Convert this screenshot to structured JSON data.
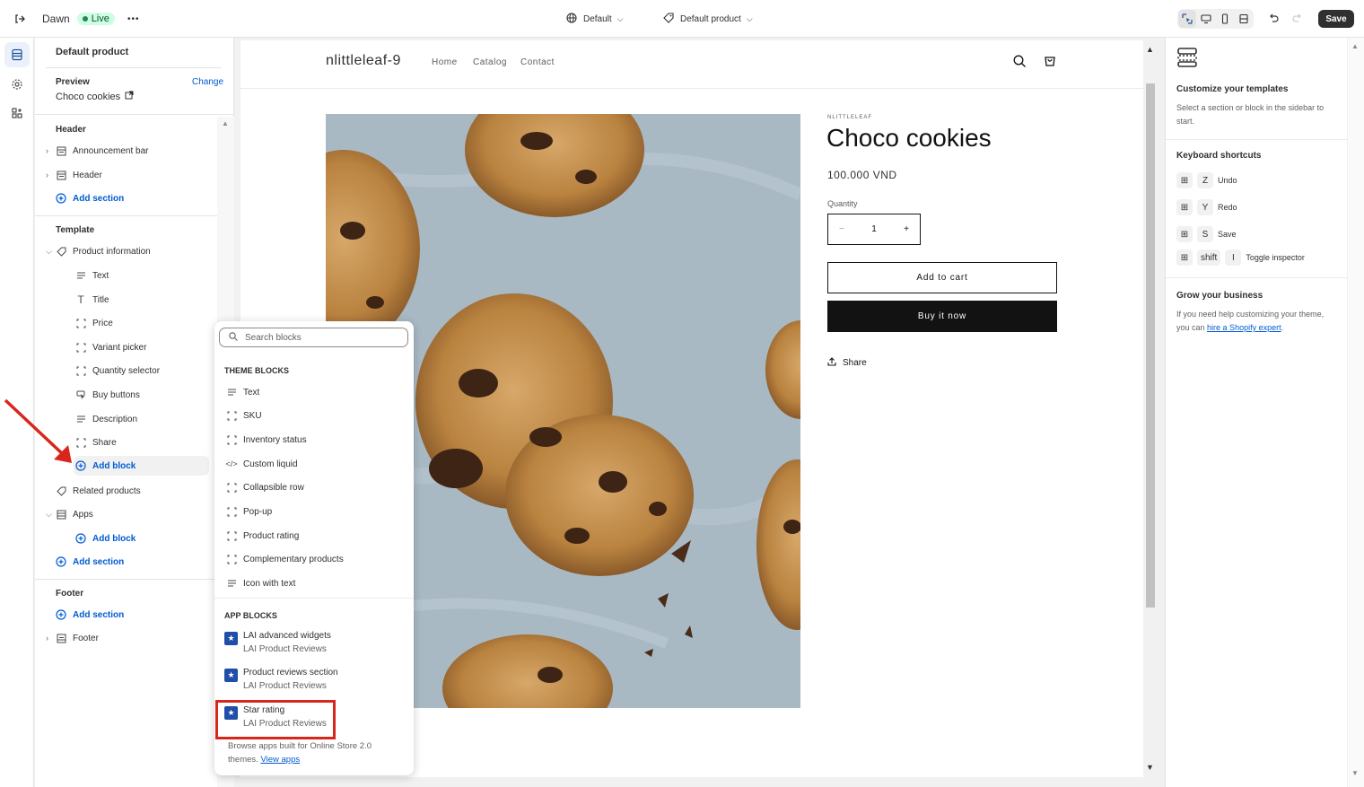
{
  "topbar": {
    "theme_name": "Dawn",
    "status": "Live",
    "more": "•••",
    "template_selector": "Default",
    "product_selector": "Default product",
    "save_label": "Save"
  },
  "sidebar": {
    "title": "Default product",
    "preview_label": "Preview",
    "preview_change": "Change",
    "preview_value": "Choco cookies",
    "header_group": "Header",
    "header_items": [
      "Announcement bar",
      "Header"
    ],
    "add_section": "Add section",
    "template_group": "Template",
    "product_information": "Product information",
    "blocks": [
      "Text",
      "Title",
      "Price",
      "Variant picker",
      "Quantity selector",
      "Buy buttons",
      "Description",
      "Share"
    ],
    "add_block": "Add block",
    "related_products": "Related products",
    "apps": "Apps",
    "footer_group": "Footer",
    "footer_item": "Footer"
  },
  "popup": {
    "search_placeholder": "Search blocks",
    "theme_blocks_heading": "THEME BLOCKS",
    "theme_blocks": [
      "Text",
      "SKU",
      "Inventory status",
      "Custom liquid",
      "Collapsible row",
      "Pop-up",
      "Product rating",
      "Complementary products",
      "Icon with text"
    ],
    "app_blocks_heading": "APP BLOCKS",
    "app_blocks": [
      {
        "name": "LAI advanced widgets",
        "vendor": "LAI Product Reviews"
      },
      {
        "name": "Product reviews section",
        "vendor": "LAI Product Reviews"
      },
      {
        "name": "Star rating",
        "vendor": "LAI Product Reviews"
      }
    ],
    "footer_text": "Browse apps built for Online Store 2.0 themes.",
    "footer_link": "View apps"
  },
  "store": {
    "name": "nlittleleaf-9",
    "nav": [
      "Home",
      "Catalog",
      "Contact"
    ],
    "vendor": "NLITTLELEAF",
    "product_title": "Choco cookies",
    "price": "100.000 VND",
    "quantity_label": "Quantity",
    "quantity_value": "1",
    "minus": "−",
    "plus": "+",
    "add_to_cart": "Add to cart",
    "buy_now": "Buy it now",
    "share": "Share"
  },
  "rightpanel": {
    "customize_title": "Customize your templates",
    "customize_text": "Select a section or block in the sidebar to start.",
    "shortcuts_title": "Keyboard shortcuts",
    "shortcuts": [
      {
        "key": "Z",
        "label": "Undo"
      },
      {
        "key": "Y",
        "label": "Redo"
      },
      {
        "key": "S",
        "label": "Save"
      }
    ],
    "inspector_keys": [
      "shift",
      "I"
    ],
    "inspector_label": "Toggle inspector",
    "grow_title": "Grow your business",
    "grow_text": "If you need help customizing your theme, you can",
    "grow_link": "hire a Shopify expert",
    "grow_end": "."
  },
  "colors": {
    "accent_blue": "#005bd3",
    "annotation_red": "#d9261c",
    "buy_now_bg": "#121212"
  }
}
